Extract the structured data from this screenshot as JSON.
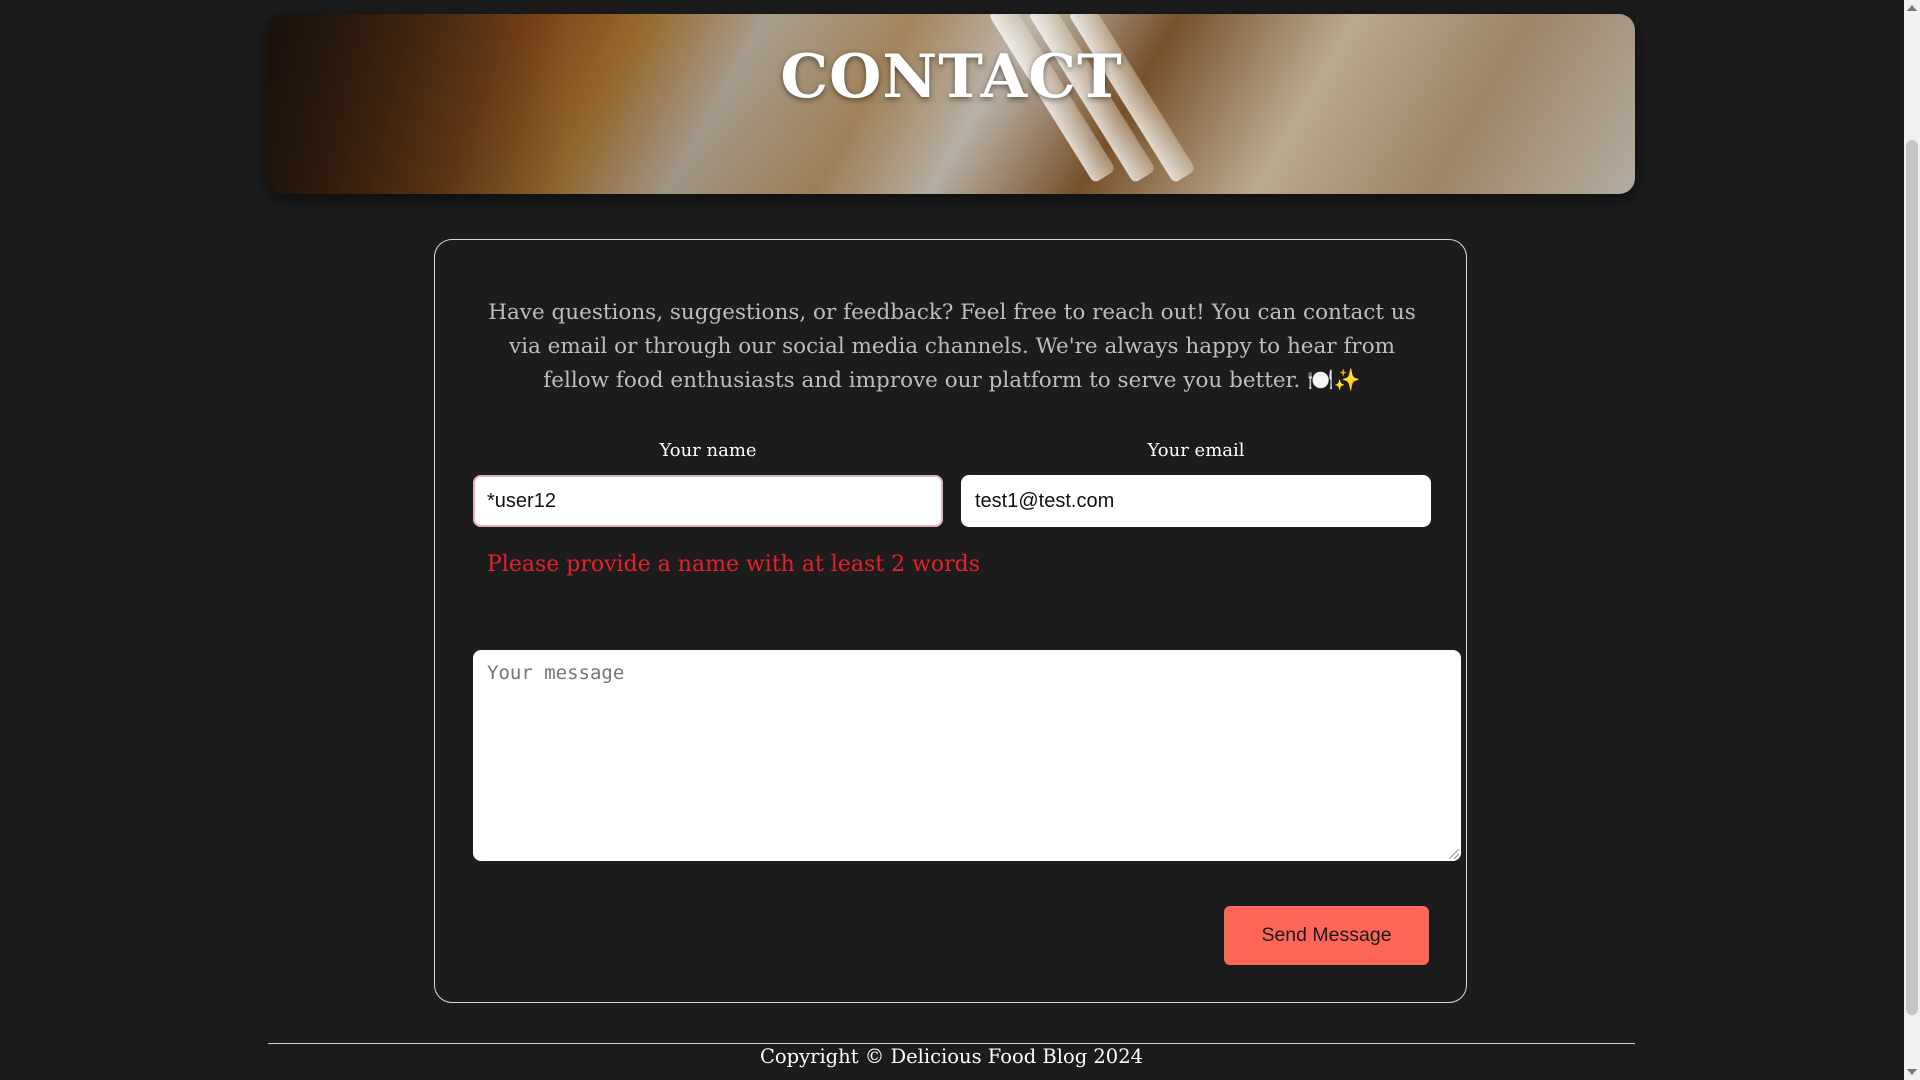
{
  "hero": {
    "title": "CONTACT"
  },
  "contact_form": {
    "intro": "Have questions, suggestions, or feedback? Feel free to reach out! You can contact us via email or through our social media channels. We're always happy to hear from fellow food enthusiasts and improve our platform to serve you better. 🍽️✨",
    "name_label": "Your name",
    "name_value": "*user12",
    "email_label": "Your email",
    "email_value": "test1@test.com",
    "name_error": "Please provide a name with at least 2 words",
    "message_placeholder": "Your message",
    "message_value": "",
    "send_label": "Send Message"
  },
  "footer": {
    "copyright": "Copyright © Delicious Food Blog 2024"
  },
  "colors": {
    "background": "#1c1c1c",
    "accent_button": "#ff665a",
    "error_text": "#e8202a"
  }
}
